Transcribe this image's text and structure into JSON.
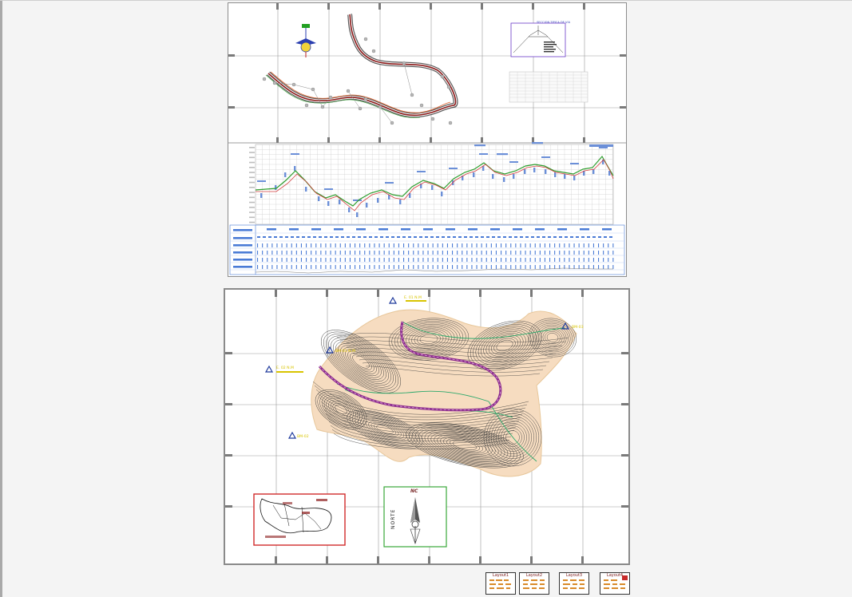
{
  "viewer": {
    "background": "#f4f4f4"
  },
  "sheet_profile": {
    "name": "plan-and-profile-sheet",
    "legend_title": "SECCION TIPICA DE VIA",
    "colors": {
      "grid": "#8c8c8c",
      "road_axis": "#8b1a1a",
      "terrain_line": "#2e9e2e",
      "grade_line": "#d33c3c",
      "profile_bars": "#6b8fd8",
      "band": "#4a7bd6"
    }
  },
  "sheet_topo": {
    "name": "topographic-plan-sheet",
    "north_label": "NORTE",
    "north_brand": "NC",
    "benchmarks": [
      {
        "label": "E. 01  N.M"
      },
      {
        "label": "E. 02  N.M"
      },
      {
        "label": "BM-01  N.M"
      },
      {
        "label": "BM-02"
      },
      {
        "label": "BM-03"
      }
    ],
    "colors": {
      "contour": "#3a3a3a",
      "contour_alt": "#6a6a6a",
      "road": "#8b2b8b",
      "water": "#2aa86a",
      "fill": "#f6dcc0",
      "benchmark": "#1f3a9c",
      "label": "#d8c400",
      "location_frame": "#d12a2a",
      "north_frame": "#39a839"
    }
  },
  "thumbnails": [
    {
      "label": "Layout1"
    },
    {
      "label": "Layout2"
    },
    {
      "label": "Layout3"
    },
    {
      "label": "Layout4"
    }
  ]
}
